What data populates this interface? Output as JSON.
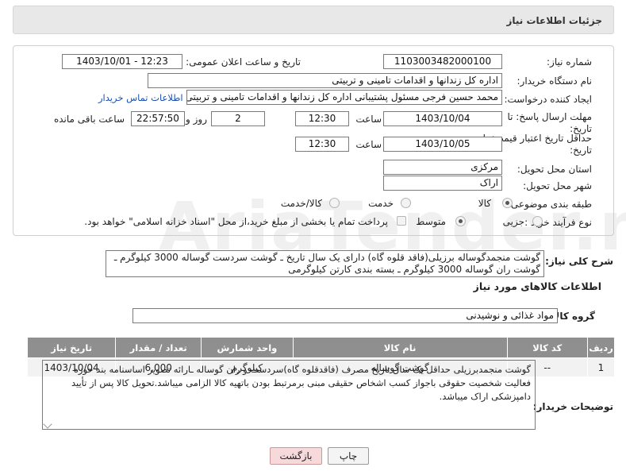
{
  "header": {
    "title": "جزئیات اطلاعات نیاز"
  },
  "form": {
    "need_number_label": "شماره نیاز:",
    "need_number": "1103003482000100",
    "announce_label": "تاریخ و ساعت اعلان عمومی:",
    "announce_value": "1403/10/01 - 12:23",
    "buyer_org_label": "نام دستگاه خریدار:",
    "buyer_org": "اداره کل زندانها و اقدامات تامینی و تربیتی",
    "creator_label": "ایجاد کننده درخواست:",
    "creator": "محمد حسین فرجی مسئول پشتیبانی اداره کل زندانها و اقدامات تامینی و تربیتی",
    "contact_link": "اطلاعات تماس خریدار",
    "deadline_label_1": "مهلت ارسال پاسخ: تا",
    "deadline_label_2": "تاریخ:",
    "deadline_date": "1403/10/04",
    "time_label": "ساعت",
    "deadline_time": "12:30",
    "days_value": "2",
    "days_label": "روز و",
    "remaining_value": "22:57:50",
    "remaining_label": "ساعت باقی مانده",
    "validity_label_1": "حداقل تاریخ اعتبار قیمت: تا",
    "validity_label_2": "تاریخ:",
    "validity_date": "1403/10/05",
    "validity_time": "12:30",
    "province_label": "استان محل تحویل:",
    "province": "مرکزی",
    "city_label": "شهر محل تحویل:",
    "city": "اراک",
    "category_label": "طبقه بندی موضوعی:",
    "category_options": [
      "کالا",
      "خدمت",
      "کالا/خدمت"
    ],
    "process_label": "نوع فرآیند خرید :",
    "process_options": [
      "جزیی",
      "متوسط"
    ],
    "payment_note": "پرداخت تمام یا بخشی از مبلغ خرید،از محل \"اسناد خزانه اسلامی\" خواهد بود."
  },
  "watermark": "AriaTender.net",
  "summary": {
    "label": "شرح کلی نیاز:",
    "text_line1": "گوشت منجمدگوساله برزیلی(فاقد قلوه گاه) دارای یک سال تاریخ ـ گوشت سردست گوساله 3000 کیلوگرم ـ",
    "text_line2": "گوشت ران گوساله 3000 کیلوگرم ـ بسته بندی کارتن کیلوگرمی"
  },
  "items_section": {
    "title": "اطلاعات کالاهای مورد نیاز",
    "group_label": "گروه کالا:",
    "group_value": "مواد غذائی و نوشیدنی",
    "columns": [
      "ردیف",
      "کد کالا",
      "نام کالا",
      "واحد شمارش",
      "تعداد / مقدار",
      "تاریخ نیاز"
    ],
    "rows": [
      [
        "1",
        "--",
        "گوشت گوساله",
        "کیلوگرم",
        "6,000",
        "1403/10/04"
      ]
    ]
  },
  "buyer_notes": {
    "label": "توضیحات خریدار:",
    "line1": "گوشت منجمدبرزیلی حداقل یک سال تاریخ مصرف (فاقدقلوه گاه)سردست و ران گوساله ـارائه تصویر اساسنامه بند حوزه",
    "line2": "فعالیت شخصیت حقوقی باجواز کسب اشخاص حقیقی مبنی برمرتبط بودن باتهیه کالا الزامی میباشد.تحویل کالا پس از تأیید",
    "line3": "دامپزشکی اراک میباشد."
  },
  "buttons": {
    "print": "چاپ",
    "back": "بازگشت"
  },
  "colors": {
    "table_header": "#8f8f8f",
    "link": "#1a4fb3",
    "back_button": "#f7d9dc"
  }
}
